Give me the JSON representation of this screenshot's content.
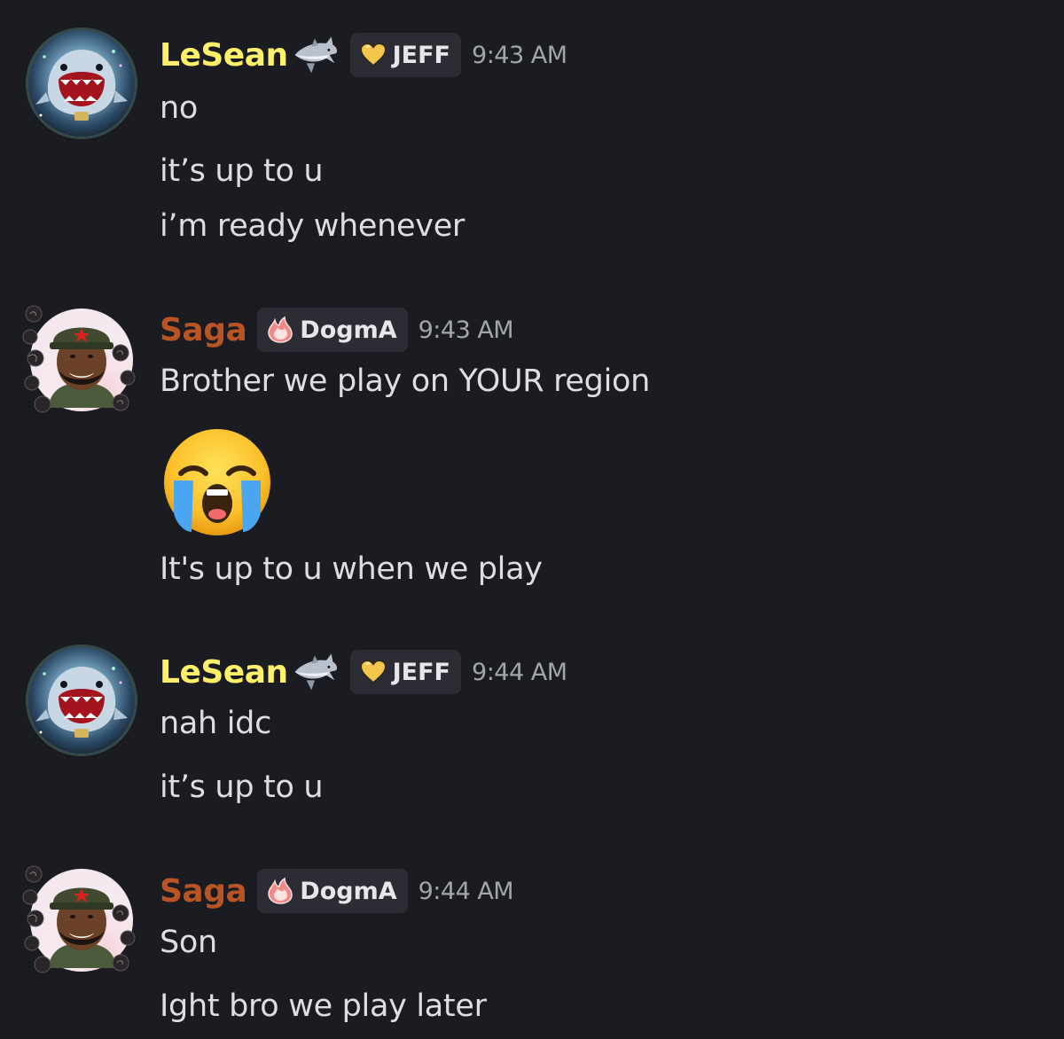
{
  "messages": [
    {
      "user": "LeSean",
      "role": "JEFF",
      "time": "9:43 AM",
      "lines": [
        "no",
        "it’s up to u",
        "i’m ready whenever"
      ],
      "name_color": "#ffef6b",
      "name_icon": "shark-icon",
      "role_icon": "gold-heart-icon"
    },
    {
      "user": "Saga",
      "role": "DogmA",
      "time": "9:43 AM",
      "lines": [
        "Brother we play on YOUR region",
        "It's up to u when we play"
      ],
      "emoji": "loudly-crying-face-emoji",
      "name_color": "#b95425",
      "role_icon": "pink-flame-icon"
    },
    {
      "user": "LeSean",
      "role": "JEFF",
      "time": "9:44 AM",
      "lines": [
        "nah idc",
        "it’s up to u"
      ],
      "name_color": "#ffef6b",
      "name_icon": "shark-icon",
      "role_icon": "gold-heart-icon"
    },
    {
      "user": "Saga",
      "role": "DogmA",
      "time": "9:44 AM",
      "lines": [
        "Son",
        "Ight bro we play later"
      ],
      "name_color": "#b95425",
      "role_icon": "pink-flame-icon"
    }
  ],
  "colors": {
    "background": "#1b1c21",
    "role_tag_bg": "#2c2d34",
    "text": "#dddee2",
    "timestamp": "#a3a5ad"
  }
}
